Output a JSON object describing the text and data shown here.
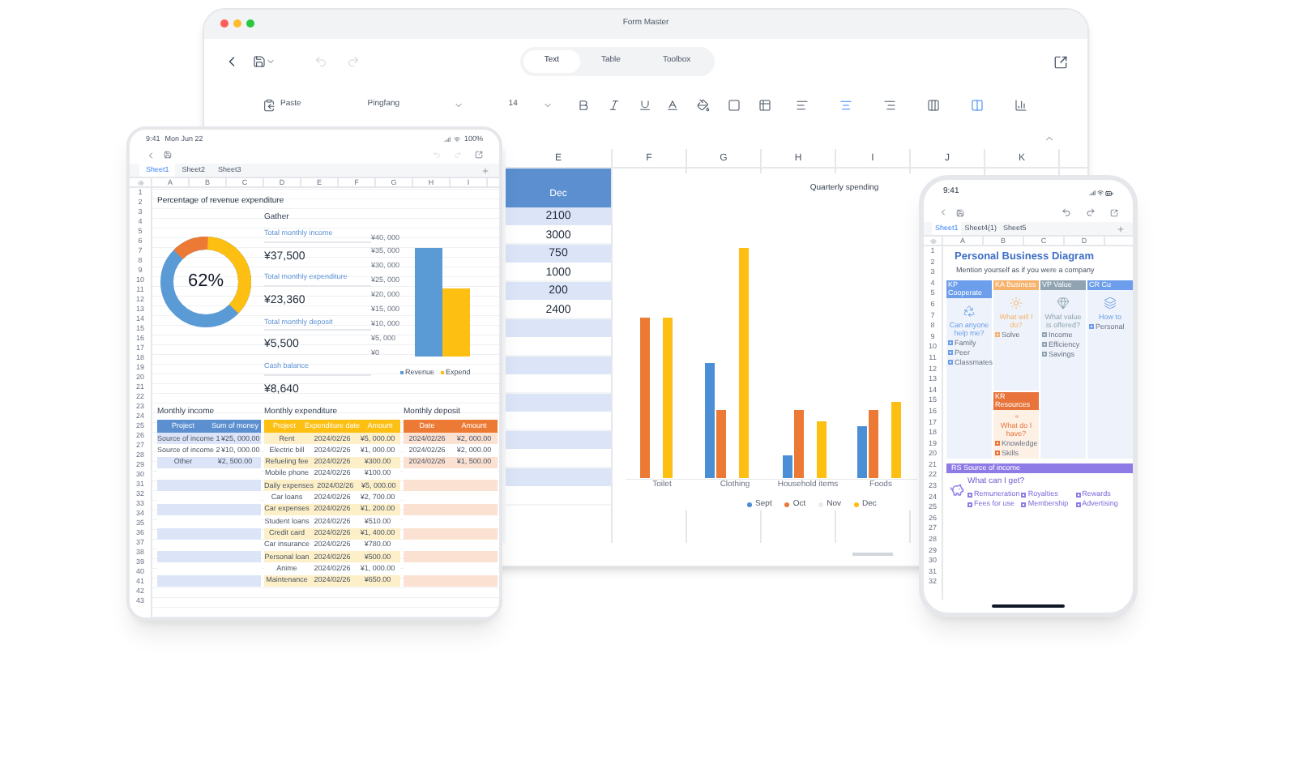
{
  "laptop": {
    "title": "Form Master",
    "tabs": [
      {
        "label": "Text",
        "selected": true
      },
      {
        "label": "Table",
        "selected": false
      },
      {
        "label": "Toolbox",
        "selected": false
      }
    ],
    "format_bar": {
      "paste": "Paste",
      "font": "Pingfang",
      "size": "14"
    },
    "columns": [
      "E",
      "F",
      "G",
      "H",
      "I",
      "J",
      "K"
    ],
    "column_e": {
      "header": "Dec",
      "values": [
        "2100",
        "3000",
        "750",
        "1000",
        "200",
        "2400"
      ]
    },
    "chart": {
      "title": "Quarterly spending",
      "categories": [
        "Toilet",
        "Clothing",
        "Household items",
        "Foods"
      ],
      "legend": [
        {
          "name": "Sept",
          "color": "#4a8fd6"
        },
        {
          "name": "Oct",
          "color": "#ec7a34"
        },
        {
          "name": "Nov",
          "color": "#ececec"
        },
        {
          "name": "Dec",
          "color": "#fdbf12"
        }
      ]
    }
  },
  "tablet": {
    "time": "9:41",
    "date": "Mon Jun 22",
    "battery": "100%",
    "sheets": [
      {
        "label": "Sheet1",
        "selected": true
      },
      {
        "label": "Sheet2",
        "selected": false
      },
      {
        "label": "Sheet3",
        "selected": false
      }
    ],
    "columns": [
      "A",
      "B",
      "C",
      "D",
      "E",
      "F",
      "G",
      "H",
      "I"
    ],
    "rows": [
      "1",
      "2",
      "3",
      "4",
      "5",
      "6",
      "7",
      "8",
      "9",
      "10",
      "11",
      "12",
      "13",
      "14",
      "15",
      "16",
      "17",
      "18",
      "19",
      "20",
      "21",
      "22",
      "23",
      "24",
      "25",
      "26",
      "27",
      "28",
      "29",
      "30",
      "31",
      "32",
      "33",
      "34",
      "35",
      "36",
      "37",
      "38",
      "39",
      "40",
      "41",
      "42",
      "43"
    ],
    "title": "Percentage of revenue expenditure",
    "donut_label": "62%",
    "summary_title": "Gather",
    "summary": [
      {
        "label": "Total monthly income",
        "value": "¥37,500"
      },
      {
        "label": "Total monthly expenditure",
        "value": "¥23,360"
      },
      {
        "label": "Total monthly deposit",
        "value": "¥5,500"
      },
      {
        "label": "Cash balance",
        "value": "¥8,640"
      }
    ],
    "bar_chart": {
      "legend": [
        {
          "name": "Revenue",
          "color": "#5b9bd5"
        },
        {
          "name": "Expend",
          "color": "#fdbf12"
        }
      ],
      "axis_labels": [
        "¥40, 000",
        "¥35, 000",
        "¥30, 000",
        "¥25, 000",
        "¥20, 000",
        "¥15, 000",
        "¥10, 000",
        "¥5, 000",
        "¥0"
      ]
    },
    "income": {
      "title": "Monthly income",
      "headers": [
        "Project",
        "Sum of money"
      ],
      "rows": [
        [
          "Source of income 1",
          "¥25, 000.00"
        ],
        [
          "Source of income 2",
          "¥10, 000.00"
        ],
        [
          "Other",
          "¥2, 500.00"
        ]
      ]
    },
    "expenditure": {
      "title": "Monthly expenditure",
      "headers": [
        "Project",
        "Expenditure date",
        "Amount"
      ],
      "rows": [
        [
          "Rent",
          "2024/02/26",
          "¥5, 000.00"
        ],
        [
          "Electric bill",
          "2024/02/26",
          "¥1, 000.00"
        ],
        [
          "Refueling fee",
          "2024/02/26",
          "¥300.00"
        ],
        [
          "Mobile phone",
          "2024/02/26",
          "¥100.00"
        ],
        [
          "Daily expenses",
          "2024/02/26",
          "¥5, 000.00"
        ],
        [
          "Car loans",
          "2024/02/26",
          "¥2, 700.00"
        ],
        [
          "Car expenses",
          "2024/02/26",
          "¥1, 200.00"
        ],
        [
          "Student loans",
          "2024/02/26",
          "¥510.00"
        ],
        [
          "Credit card",
          "2024/02/26",
          "¥1, 400.00"
        ],
        [
          "Car insurance",
          "2024/02/26",
          "¥780.00"
        ],
        [
          "Personal loan",
          "2024/02/26",
          "¥500.00"
        ],
        [
          "Anime",
          "2024/02/26",
          "¥1, 000.00"
        ],
        [
          "Maintenance",
          "2024/02/26",
          "¥650.00"
        ]
      ]
    },
    "deposit": {
      "title": "Monthly deposit",
      "headers": [
        "Date",
        "Amount"
      ],
      "rows": [
        [
          "2024/02/26",
          "¥2, 000.00"
        ],
        [
          "2024/02/26",
          "¥2, 000.00"
        ],
        [
          "2024/02/26",
          "¥1, 500.00"
        ]
      ]
    }
  },
  "phone": {
    "time": "9:41",
    "sheets": [
      {
        "label": "Sheet1",
        "selected": true
      },
      {
        "label": "Sheet4(1)",
        "selected": false
      },
      {
        "label": "Sheet5",
        "selected": false
      }
    ],
    "columns": [
      "A",
      "B",
      "C",
      "D"
    ],
    "rows": [
      "1",
      "2",
      "3",
      "4",
      "5",
      "6",
      "7",
      "8",
      "9",
      "10",
      "11",
      "12",
      "13",
      "14",
      "15",
      "16",
      "17",
      "18",
      "19",
      "20",
      "21",
      "22",
      "23",
      "24",
      "25",
      "26",
      "27",
      "28",
      "29",
      "30",
      "31",
      "32"
    ],
    "title": "Personal Business Diagram",
    "subtitle": "Mention yourself as if you were a company",
    "cards": [
      {
        "heading": "KP Cooperate",
        "color": "#6d9eeb",
        "question": "Can anyone help me?",
        "options": [
          "Family",
          "Peer",
          "Classmates"
        ]
      },
      {
        "heading": "KA Business",
        "color": "#f6b26b",
        "question": "What will I do?",
        "options": [
          "Solve"
        ],
        "sub": {
          "heading": "KR Resources",
          "color": "#e8743b",
          "question": "What do I have?",
          "options": [
            "Knowledge",
            "Skills"
          ]
        }
      },
      {
        "heading": "VP Value",
        "color": "#8fa3b0",
        "question": "What value is offered?",
        "options": [
          "Income",
          "Efficiency",
          "Savings"
        ]
      },
      {
        "heading": "CR Cu",
        "color": "#6d9eeb",
        "question": "How to",
        "options": [
          "Personal"
        ]
      }
    ],
    "income_band": "RS Source of income",
    "income_question": "What can I get?",
    "income_options": [
      "Remuneration",
      "Royalties",
      "Rewards",
      "Fees for use",
      "Membership",
      "Advertising"
    ]
  }
}
